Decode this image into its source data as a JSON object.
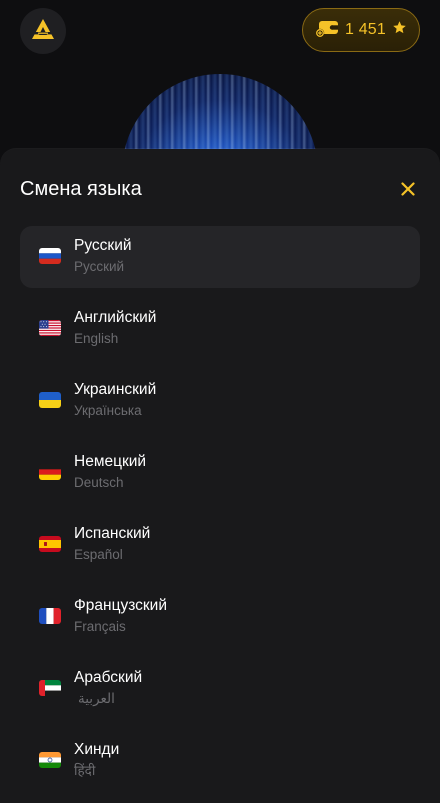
{
  "header": {
    "logo_icon": "app-logo-triangle-icon",
    "balance": {
      "icon": "ticket-plus-icon",
      "value": "1 451",
      "star_icon": "star-icon"
    }
  },
  "colors": {
    "accent": "#f5c228",
    "sheet_bg": "#19191b",
    "active_row_bg": "#252528",
    "secondary_text": "#6c6c70"
  },
  "sheet": {
    "title": "Смена языка",
    "close_icon": "close-icon",
    "languages": [
      {
        "name": "Русский",
        "native": "Русский",
        "flag": "flag-russia-icon",
        "active": true
      },
      {
        "name": "Английский",
        "native": "English",
        "flag": "flag-usa-icon",
        "active": false
      },
      {
        "name": "Украинский",
        "native": "Українська",
        "flag": "flag-ukraine-icon",
        "active": false
      },
      {
        "name": "Немецкий",
        "native": "Deutsch",
        "flag": "flag-germany-icon",
        "active": false
      },
      {
        "name": "Испанский",
        "native": "Español",
        "flag": "flag-spain-icon",
        "active": false
      },
      {
        "name": "Французский",
        "native": "Français",
        "flag": "flag-france-icon",
        "active": false
      },
      {
        "name": "Арабский",
        "native": "العربية",
        "flag": "flag-uae-icon",
        "active": false
      },
      {
        "name": "Хинди",
        "native": "हिंदी",
        "flag": "flag-india-icon",
        "active": false
      }
    ]
  }
}
